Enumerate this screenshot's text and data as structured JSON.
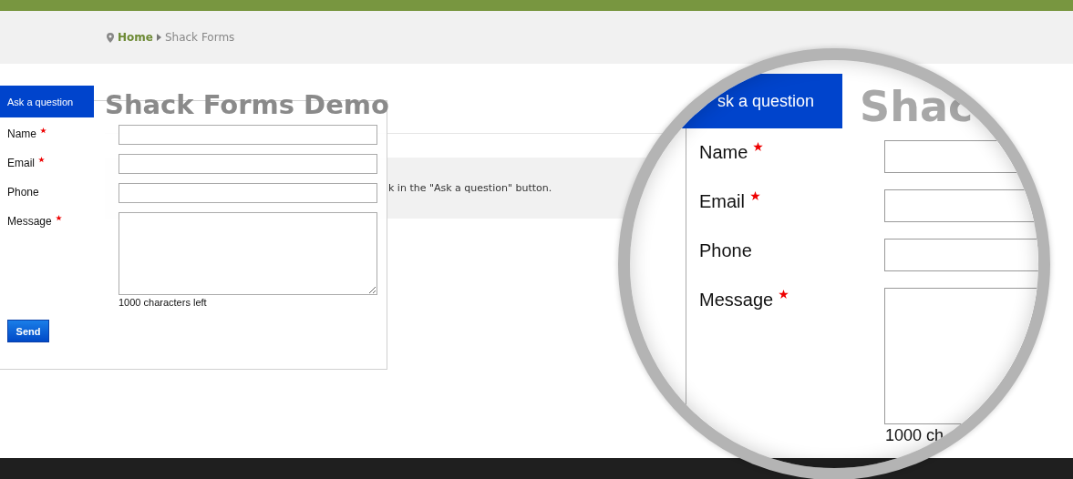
{
  "breadcrumb": {
    "items": [
      {
        "label": "Home",
        "kind": "link"
      },
      {
        "label": "Shack Forms",
        "kind": "current"
      }
    ]
  },
  "page": {
    "title": "Shack Forms Demo",
    "notice": "k in the \"Ask a question\" button."
  },
  "form": {
    "tab": "Ask a question",
    "fields": [
      {
        "label": "Name",
        "required": true,
        "kind": "input"
      },
      {
        "label": "Email",
        "required": true,
        "kind": "input"
      },
      {
        "label": "Phone",
        "required": false,
        "kind": "input"
      },
      {
        "label": "Message",
        "required": true,
        "kind": "textarea"
      }
    ],
    "counter": "1000 characters left",
    "button": "Send"
  },
  "magnifier": {
    "tab": "sk a question",
    "heading": "Shac",
    "fields": [
      {
        "label": "Name",
        "required": true,
        "kind": "input"
      },
      {
        "label": "Email",
        "required": true,
        "kind": "input"
      },
      {
        "label": "Phone",
        "required": false,
        "kind": "input"
      },
      {
        "label": "Message",
        "required": true,
        "kind": "textarea"
      }
    ],
    "counter": "1000 ch"
  }
}
